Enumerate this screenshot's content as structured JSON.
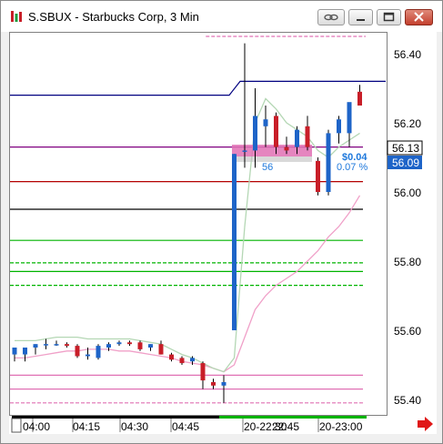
{
  "window": {
    "title": "S.SBUX - Starbucks Corp, 3 Min"
  },
  "price_axis": {
    "ticks": [
      "56.40",
      "56.20",
      "56.00",
      "55.80",
      "55.60",
      "55.40"
    ],
    "current_price_label": "56.13",
    "current_price_label_2": "56.09"
  },
  "time_axis": {
    "ticks": [
      "04:00",
      "04:15",
      "04:30",
      "04:45",
      "20-22:30",
      "22:45",
      "20-23:00"
    ]
  },
  "trade_marker": {
    "change": "$0.04",
    "change_pct": "0.07 %",
    "shares": "56"
  },
  "colors": {
    "bull": "#1e64c8",
    "bear": "#c81e28",
    "trade_zone": "#e070b4",
    "level_blue": "#000080",
    "level_purple": "#800080",
    "level_red": "#b40000",
    "level_green": "#00b400",
    "ma_fast": "#b4d7b4",
    "ma_slow": "#f0a0c8"
  },
  "chart_data": {
    "type": "candlestick",
    "ylim": [
      55.37,
      56.47
    ],
    "candles": [
      {
        "o": 55.53,
        "h": 55.55,
        "l": 55.51,
        "c": 55.55
      },
      {
        "o": 55.53,
        "h": 55.55,
        "l": 55.51,
        "c": 55.55
      },
      {
        "o": 55.55,
        "h": 55.56,
        "l": 55.53,
        "c": 55.56
      },
      {
        "o": 55.56,
        "h": 55.575,
        "l": 55.545,
        "c": 55.56
      },
      {
        "o": 55.56,
        "h": 55.57,
        "l": 55.555,
        "c": 55.56
      },
      {
        "o": 55.56,
        "h": 55.565,
        "l": 55.55,
        "c": 55.555
      },
      {
        "o": 55.555,
        "h": 55.56,
        "l": 55.52,
        "c": 55.525
      },
      {
        "o": 55.525,
        "h": 55.55,
        "l": 55.515,
        "c": 55.53
      },
      {
        "o": 55.52,
        "h": 55.56,
        "l": 55.515,
        "c": 55.555
      },
      {
        "o": 55.55,
        "h": 55.565,
        "l": 55.54,
        "c": 55.56
      },
      {
        "o": 55.56,
        "h": 55.57,
        "l": 55.555,
        "c": 55.565
      },
      {
        "o": 55.565,
        "h": 55.57,
        "l": 55.555,
        "c": 55.56
      },
      {
        "o": 55.565,
        "h": 55.57,
        "l": 55.54,
        "c": 55.545
      },
      {
        "o": 55.55,
        "h": 55.56,
        "l": 55.54,
        "c": 55.56
      },
      {
        "o": 55.56,
        "h": 55.57,
        "l": 55.53,
        "c": 55.53
      },
      {
        "o": 55.53,
        "h": 55.535,
        "l": 55.51,
        "c": 55.515
      },
      {
        "o": 55.52,
        "h": 55.525,
        "l": 55.5,
        "c": 55.505
      },
      {
        "o": 55.51,
        "h": 55.525,
        "l": 55.5,
        "c": 55.52
      },
      {
        "o": 55.505,
        "h": 55.51,
        "l": 55.43,
        "c": 55.455
      },
      {
        "o": 55.45,
        "h": 55.46,
        "l": 55.43,
        "c": 55.44
      },
      {
        "o": 55.44,
        "h": 55.47,
        "l": 55.39,
        "c": 55.45
      },
      {
        "o": 55.6,
        "h": 56.11,
        "l": 55.6,
        "c": 56.11
      },
      {
        "o": 56.12,
        "h": 56.43,
        "l": 56.07,
        "c": 56.12
      },
      {
        "o": 56.12,
        "h": 56.3,
        "l": 56.07,
        "c": 56.22
      },
      {
        "o": 56.19,
        "h": 56.25,
        "l": 56.13,
        "c": 56.21
      },
      {
        "o": 56.22,
        "h": 56.23,
        "l": 56.11,
        "c": 56.13
      },
      {
        "o": 56.13,
        "h": 56.16,
        "l": 56.11,
        "c": 56.12
      },
      {
        "o": 56.13,
        "h": 56.19,
        "l": 56.11,
        "c": 56.18
      },
      {
        "o": 56.19,
        "h": 56.22,
        "l": 56.12,
        "c": 56.13
      },
      {
        "o": 56.09,
        "h": 56.1,
        "l": 55.99,
        "c": 56.0
      },
      {
        "o": 56.0,
        "h": 56.18,
        "l": 55.99,
        "c": 56.17
      },
      {
        "o": 56.17,
        "h": 56.22,
        "l": 56.14,
        "c": 56.21
      },
      {
        "o": 56.17,
        "h": 56.24,
        "l": 56.13,
        "c": 56.26
      },
      {
        "o": 56.29,
        "h": 56.31,
        "l": 56.25,
        "c": 56.25
      }
    ],
    "levels": [
      {
        "price": 56.45,
        "color": "#e070b4",
        "style": "dashed",
        "from": 0.52
      },
      {
        "price": 56.28,
        "color": "#000080",
        "style": "solid",
        "step_to": 56.32
      },
      {
        "price": 56.13,
        "color": "#800080",
        "style": "solid",
        "from": 0.0
      },
      {
        "price": 56.03,
        "color": "#b40000",
        "style": "solid"
      },
      {
        "price": 55.95,
        "color": "#000000",
        "style": "solid"
      },
      {
        "price": 55.86,
        "color": "#00b400",
        "style": "solid"
      },
      {
        "price": 55.795,
        "color": "#00b400",
        "style": "dashed"
      },
      {
        "price": 55.77,
        "color": "#00b400",
        "style": "solid"
      },
      {
        "price": 55.73,
        "color": "#00b400",
        "style": "dashed"
      },
      {
        "price": 55.47,
        "color": "#e070b4",
        "style": "solid"
      },
      {
        "price": 55.43,
        "color": "#e070b4",
        "style": "solid"
      },
      {
        "price": 55.39,
        "color": "#e070b4",
        "style": "dashed"
      }
    ],
    "ma_fast": [
      55.57,
      55.57,
      55.57,
      55.575,
      55.58,
      55.58,
      55.58,
      55.575,
      55.575,
      55.575,
      55.575,
      55.575,
      55.57,
      55.565,
      55.56,
      55.545,
      55.53,
      55.52,
      55.505,
      55.49,
      55.48,
      55.52,
      55.9,
      56.2,
      56.27,
      56.24,
      56.2,
      56.18,
      56.16,
      56.12,
      56.1,
      56.13,
      56.15,
      56.17
    ],
    "ma_slow": [
      55.52,
      55.52,
      55.525,
      55.53,
      55.535,
      55.54,
      55.54,
      55.545,
      55.545,
      55.545,
      55.54,
      55.54,
      55.535,
      55.53,
      55.525,
      55.52,
      55.51,
      55.505,
      55.5,
      55.49,
      55.48,
      55.5,
      55.58,
      55.66,
      55.7,
      55.73,
      55.75,
      55.77,
      55.8,
      55.83,
      55.87,
      55.9,
      55.94,
      55.99
    ]
  }
}
